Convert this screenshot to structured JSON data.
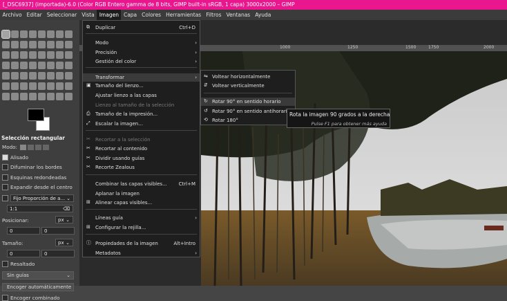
{
  "window": {
    "title": "[_DSC6937] (importada)-6.0 (Color RGB Entero gamma de 8 bits, GIMP built-in sRGB, 1 capa) 3000x2000 – GIMP"
  },
  "menubar": [
    "Archivo",
    "Editar",
    "Seleccionar",
    "Vista",
    "Imagen",
    "Capa",
    "Colores",
    "Herramientas",
    "Filtros",
    "Ventanas",
    "Ayuda"
  ],
  "tool_options": {
    "title": "Selección rectangular",
    "mode_label": "Modo:",
    "antialias": "Alisado",
    "feather": "Difuminar los bordes",
    "rounded": "Esquinas redondeadas",
    "expand": "Expandir desde el centro",
    "fixed": "Fijo Proporción de a...",
    "ratio": "1:1",
    "position_label": "Posicionar:",
    "position_unit": "px",
    "pos_x": "0",
    "pos_y": "0",
    "size_label": "Tamaño:",
    "size_unit": "px",
    "size_w": "0",
    "size_h": "0",
    "highlight": "Resaltado",
    "guides": "Sin guías",
    "autoshrink": "Encoger automáticamente",
    "shrink_merged": "Encoger combinado"
  },
  "ruler": [
    "1000",
    "1250",
    "1500",
    "1750",
    "2000"
  ],
  "image_menu": {
    "items": [
      {
        "label": "Duplicar",
        "accel": "Ctrl+D",
        "icon": "⧉"
      },
      {
        "label": "Modo",
        "sub": "›"
      },
      {
        "label": "Precisión",
        "sub": "›"
      },
      {
        "label": "Gestión del color",
        "sub": "›"
      },
      {
        "label": "Transformar",
        "sub": "›"
      },
      {
        "label": "Tamaño del lienzo...",
        "icon": "▣"
      },
      {
        "label": "Ajustar lienzo a las capas"
      },
      {
        "label": "Lienzo al tamaño de la selección"
      },
      {
        "label": "Tamaño de la impresión...",
        "icon": "⎙"
      },
      {
        "label": "Escalar la imagen...",
        "icon": "⤢"
      },
      {
        "label": "Recortar a la selección",
        "icon": "✂"
      },
      {
        "label": "Recortar al contenido",
        "icon": "✂"
      },
      {
        "label": "Dividir usando guías",
        "icon": "✂"
      },
      {
        "label": "Recorte Zealous",
        "icon": "✂"
      },
      {
        "label": "Combinar las capas visibles...",
        "accel": "Ctrl+M"
      },
      {
        "label": "Aplanar la imagen"
      },
      {
        "label": "Alinear capas visibles...",
        "icon": "⊞"
      },
      {
        "label": "Líneas guía",
        "sub": "›"
      },
      {
        "label": "Configurar la rejilla...",
        "icon": "⊞"
      },
      {
        "label": "Propiedades de la imagen",
        "accel": "Alt+Intro",
        "icon": "ⓘ"
      },
      {
        "label": "Metadatos",
        "sub": "›"
      }
    ]
  },
  "transform_submenu": {
    "items": [
      {
        "label": "Voltear horizontalmente",
        "icon": "⇋"
      },
      {
        "label": "Voltear verticalmente",
        "icon": "⇵"
      },
      {
        "label": "Rotar 90° en sentido horario",
        "icon": "↻"
      },
      {
        "label": "Rotar 90° en sentido antihorario",
        "icon": "↺"
      },
      {
        "label": "Rotar 180°",
        "icon": "⟲"
      }
    ]
  },
  "tooltip": {
    "main": "Rota la imagen 90 grados a la derecha",
    "hint": "Pulse F1 para obtener más ayuda"
  }
}
